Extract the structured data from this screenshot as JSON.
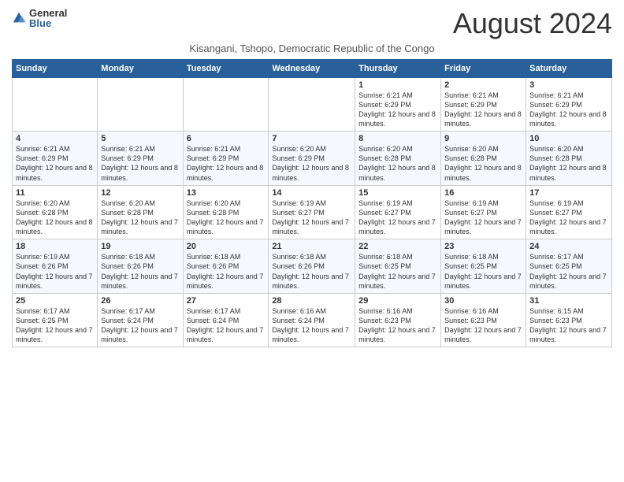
{
  "logo": {
    "general": "General",
    "blue": "Blue"
  },
  "title": {
    "month_year": "August 2024",
    "location": "Kisangani, Tshopo, Democratic Republic of the Congo"
  },
  "days_of_week": [
    "Sunday",
    "Monday",
    "Tuesday",
    "Wednesday",
    "Thursday",
    "Friday",
    "Saturday"
  ],
  "weeks": [
    [
      {
        "day": "",
        "info": ""
      },
      {
        "day": "",
        "info": ""
      },
      {
        "day": "",
        "info": ""
      },
      {
        "day": "",
        "info": ""
      },
      {
        "day": "1",
        "info": "Sunrise: 6:21 AM\nSunset: 6:29 PM\nDaylight: 12 hours and 8 minutes."
      },
      {
        "day": "2",
        "info": "Sunrise: 6:21 AM\nSunset: 6:29 PM\nDaylight: 12 hours and 8 minutes."
      },
      {
        "day": "3",
        "info": "Sunrise: 6:21 AM\nSunset: 6:29 PM\nDaylight: 12 hours and 8 minutes."
      }
    ],
    [
      {
        "day": "4",
        "info": "Sunrise: 6:21 AM\nSunset: 6:29 PM\nDaylight: 12 hours and 8 minutes."
      },
      {
        "day": "5",
        "info": "Sunrise: 6:21 AM\nSunset: 6:29 PM\nDaylight: 12 hours and 8 minutes."
      },
      {
        "day": "6",
        "info": "Sunrise: 6:21 AM\nSunset: 6:29 PM\nDaylight: 12 hours and 8 minutes."
      },
      {
        "day": "7",
        "info": "Sunrise: 6:20 AM\nSunset: 6:29 PM\nDaylight: 12 hours and 8 minutes."
      },
      {
        "day": "8",
        "info": "Sunrise: 6:20 AM\nSunset: 6:28 PM\nDaylight: 12 hours and 8 minutes."
      },
      {
        "day": "9",
        "info": "Sunrise: 6:20 AM\nSunset: 6:28 PM\nDaylight: 12 hours and 8 minutes."
      },
      {
        "day": "10",
        "info": "Sunrise: 6:20 AM\nSunset: 6:28 PM\nDaylight: 12 hours and 8 minutes."
      }
    ],
    [
      {
        "day": "11",
        "info": "Sunrise: 6:20 AM\nSunset: 6:28 PM\nDaylight: 12 hours and 8 minutes."
      },
      {
        "day": "12",
        "info": "Sunrise: 6:20 AM\nSunset: 6:28 PM\nDaylight: 12 hours and 7 minutes."
      },
      {
        "day": "13",
        "info": "Sunrise: 6:20 AM\nSunset: 6:28 PM\nDaylight: 12 hours and 7 minutes."
      },
      {
        "day": "14",
        "info": "Sunrise: 6:19 AM\nSunset: 6:27 PM\nDaylight: 12 hours and 7 minutes."
      },
      {
        "day": "15",
        "info": "Sunrise: 6:19 AM\nSunset: 6:27 PM\nDaylight: 12 hours and 7 minutes."
      },
      {
        "day": "16",
        "info": "Sunrise: 6:19 AM\nSunset: 6:27 PM\nDaylight: 12 hours and 7 minutes."
      },
      {
        "day": "17",
        "info": "Sunrise: 6:19 AM\nSunset: 6:27 PM\nDaylight: 12 hours and 7 minutes."
      }
    ],
    [
      {
        "day": "18",
        "info": "Sunrise: 6:19 AM\nSunset: 6:26 PM\nDaylight: 12 hours and 7 minutes."
      },
      {
        "day": "19",
        "info": "Sunrise: 6:18 AM\nSunset: 6:26 PM\nDaylight: 12 hours and 7 minutes."
      },
      {
        "day": "20",
        "info": "Sunrise: 6:18 AM\nSunset: 6:26 PM\nDaylight: 12 hours and 7 minutes."
      },
      {
        "day": "21",
        "info": "Sunrise: 6:18 AM\nSunset: 6:26 PM\nDaylight: 12 hours and 7 minutes."
      },
      {
        "day": "22",
        "info": "Sunrise: 6:18 AM\nSunset: 6:25 PM\nDaylight: 12 hours and 7 minutes."
      },
      {
        "day": "23",
        "info": "Sunrise: 6:18 AM\nSunset: 6:25 PM\nDaylight: 12 hours and 7 minutes."
      },
      {
        "day": "24",
        "info": "Sunrise: 6:17 AM\nSunset: 6:25 PM\nDaylight: 12 hours and 7 minutes."
      }
    ],
    [
      {
        "day": "25",
        "info": "Sunrise: 6:17 AM\nSunset: 6:25 PM\nDaylight: 12 hours and 7 minutes."
      },
      {
        "day": "26",
        "info": "Sunrise: 6:17 AM\nSunset: 6:24 PM\nDaylight: 12 hours and 7 minutes."
      },
      {
        "day": "27",
        "info": "Sunrise: 6:17 AM\nSunset: 6:24 PM\nDaylight: 12 hours and 7 minutes."
      },
      {
        "day": "28",
        "info": "Sunrise: 6:16 AM\nSunset: 6:24 PM\nDaylight: 12 hours and 7 minutes."
      },
      {
        "day": "29",
        "info": "Sunrise: 6:16 AM\nSunset: 6:23 PM\nDaylight: 12 hours and 7 minutes."
      },
      {
        "day": "30",
        "info": "Sunrise: 6:16 AM\nSunset: 6:23 PM\nDaylight: 12 hours and 7 minutes."
      },
      {
        "day": "31",
        "info": "Sunrise: 6:15 AM\nSunset: 6:23 PM\nDaylight: 12 hours and 7 minutes."
      }
    ]
  ]
}
